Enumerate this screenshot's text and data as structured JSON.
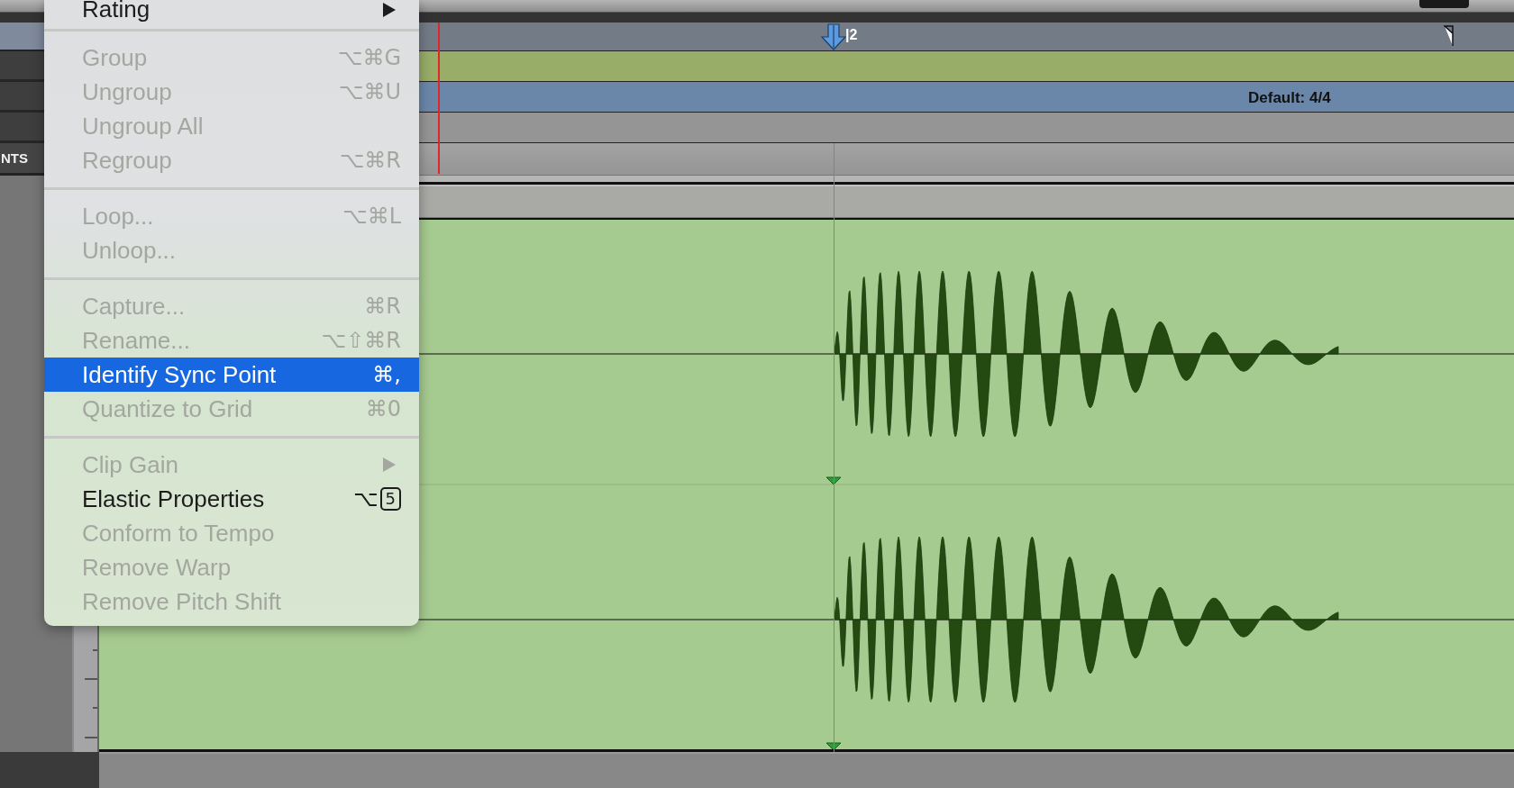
{
  "menu": {
    "items": [
      {
        "kind": "item",
        "label": "Rating",
        "disabled": false,
        "selected": false,
        "submenu": true
      },
      {
        "kind": "separator"
      },
      {
        "kind": "item",
        "label": "Group",
        "shortcut": "⌥⌘G",
        "disabled": true,
        "selected": false
      },
      {
        "kind": "item",
        "label": "Ungroup",
        "shortcut": "⌥⌘U",
        "disabled": true,
        "selected": false
      },
      {
        "kind": "item",
        "label": "Ungroup All",
        "disabled": true,
        "selected": false
      },
      {
        "kind": "item",
        "label": "Regroup",
        "shortcut": "⌥⌘R",
        "disabled": true,
        "selected": false
      },
      {
        "kind": "separator"
      },
      {
        "kind": "item",
        "label": "Loop...",
        "shortcut": "⌥⌘L",
        "disabled": true,
        "selected": false
      },
      {
        "kind": "item",
        "label": "Unloop...",
        "disabled": true,
        "selected": false
      },
      {
        "kind": "separator"
      },
      {
        "kind": "item",
        "label": "Capture...",
        "shortcut": "⌘R",
        "disabled": true,
        "selected": false
      },
      {
        "kind": "item",
        "label": "Rename...",
        "shortcut": "⌥⇧⌘R",
        "disabled": true,
        "selected": false
      },
      {
        "kind": "item",
        "label": "Identify Sync Point",
        "shortcut": "⌘,",
        "disabled": false,
        "selected": true
      },
      {
        "kind": "item",
        "label": "Quantize to Grid",
        "shortcut": "⌘0",
        "disabled": true,
        "selected": false
      },
      {
        "kind": "separator"
      },
      {
        "kind": "item",
        "label": "Clip Gain",
        "disabled": true,
        "selected": false,
        "submenu": true
      },
      {
        "kind": "item",
        "label": "Elastic Properties",
        "shortcut": "⌥",
        "key_box": "5",
        "disabled": false,
        "selected": false
      },
      {
        "kind": "item",
        "label": "Conform to Tempo",
        "disabled": true,
        "selected": false
      },
      {
        "kind": "item",
        "label": "Remove Warp",
        "disabled": true,
        "selected": false
      },
      {
        "kind": "item",
        "label": "Remove Pitch Shift",
        "disabled": true,
        "selected": false
      }
    ]
  },
  "timeline": {
    "left_label": "NTS",
    "marker_label": "|2",
    "meter_label": "Default: 4/4"
  }
}
